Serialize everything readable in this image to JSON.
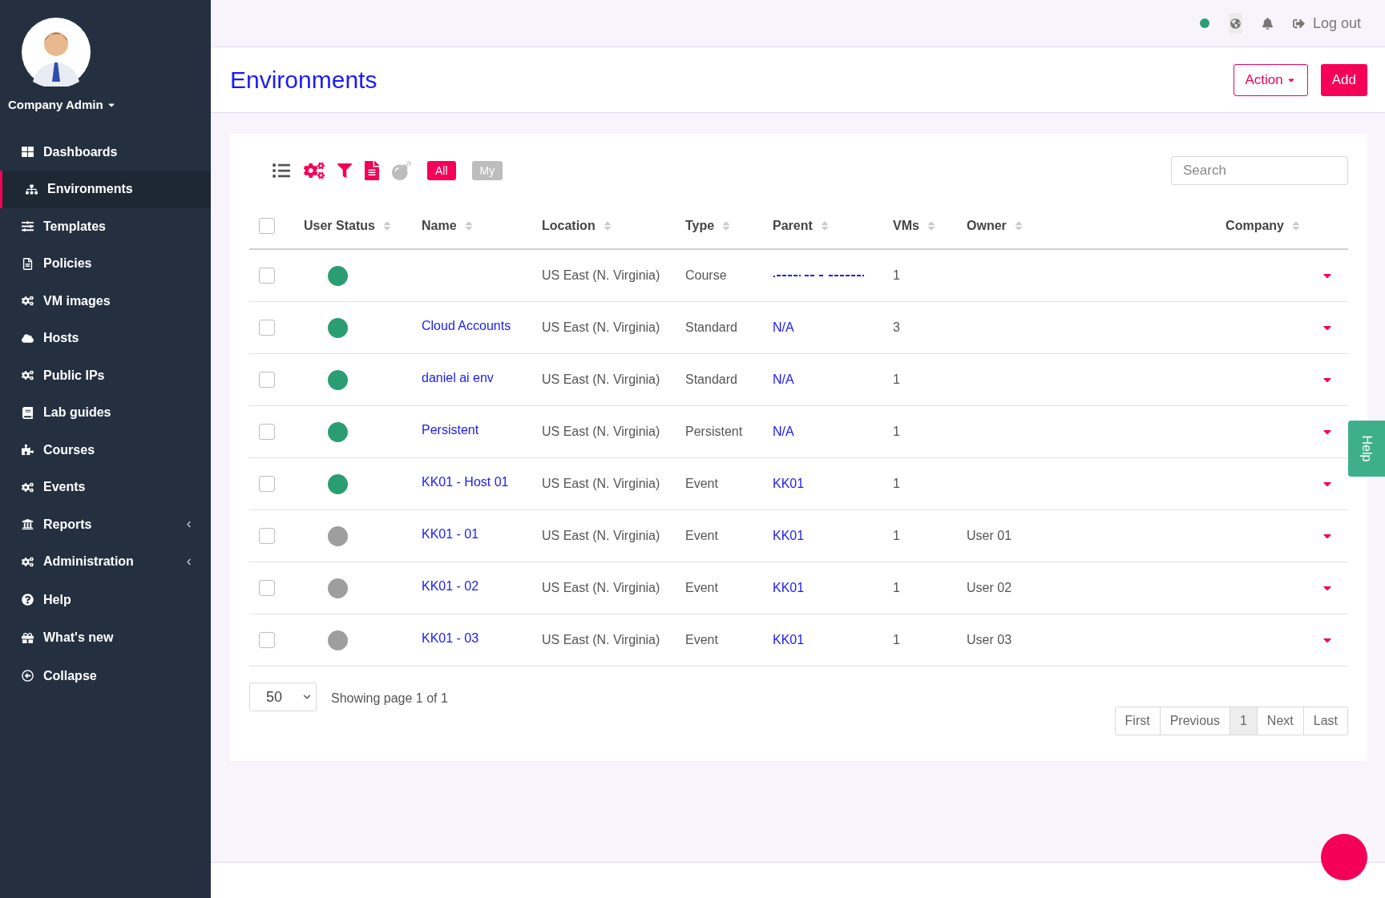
{
  "user": {
    "name": "Company Admin"
  },
  "sidebar": {
    "items": [
      {
        "label": "Dashboards",
        "selected": false,
        "expandable": false
      },
      {
        "label": "Environments",
        "selected": true,
        "expandable": false
      },
      {
        "label": "Templates",
        "selected": false,
        "expandable": false
      },
      {
        "label": "Policies",
        "selected": false,
        "expandable": false
      },
      {
        "label": "VM images",
        "selected": false,
        "expandable": false
      },
      {
        "label": "Hosts",
        "selected": false,
        "expandable": false
      },
      {
        "label": "Public IPs",
        "selected": false,
        "expandable": false
      },
      {
        "label": "Lab guides",
        "selected": false,
        "expandable": false
      },
      {
        "label": "Courses",
        "selected": false,
        "expandable": false
      },
      {
        "label": "Events",
        "selected": false,
        "expandable": false
      },
      {
        "label": "Reports",
        "selected": false,
        "expandable": true
      },
      {
        "label": "Administration",
        "selected": false,
        "expandable": true
      },
      {
        "label": "Help",
        "selected": false,
        "expandable": false
      },
      {
        "label": "What's new",
        "selected": false,
        "expandable": false
      },
      {
        "label": "Collapse",
        "selected": false,
        "expandable": false
      }
    ]
  },
  "topbar": {
    "connected": true,
    "logout": "Log out"
  },
  "page": {
    "title": "Environments",
    "action_button": "Action",
    "add_button": "Add"
  },
  "filters": [
    {
      "label": "All",
      "selected": true
    },
    {
      "label": "My",
      "selected": false
    }
  ],
  "search": {
    "placeholder": "Search"
  },
  "table": {
    "select_all": {
      "checked": false
    },
    "columns": [
      "User Status",
      "Name",
      "Location",
      "Type",
      "Parent",
      "VMs",
      "Owner",
      "Company"
    ],
    "rows": [
      {
        "checked": false,
        "color": "#2a9d73",
        "location": "US East (N. Virginia)",
        "type": "Course",
        "vms": "1"
      },
      {
        "checked": false,
        "color": "#2a9d73",
        "name": "Cloud Accounts",
        "location": "US East (N. Virginia)",
        "type": "Standard",
        "parent": "N/A",
        "vms": "3"
      },
      {
        "checked": false,
        "color": "#2a9d73",
        "name": "daniel ai env",
        "location": "US East (N. Virginia)",
        "type": "Standard",
        "parent": "N/A",
        "vms": "1"
      },
      {
        "checked": false,
        "color": "#2a9d73",
        "name": "Persistent",
        "location": "US East (N. Virginia)",
        "type": "Persistent",
        "parent": "N/A",
        "vms": "1"
      },
      {
        "checked": false,
        "color": "#2a9d73",
        "name": "KK01 - Host 01",
        "location": "US East (N. Virginia)",
        "type": "Event",
        "parent": "KK01",
        "vms": "1"
      },
      {
        "checked": false,
        "color": "#9e9e9e",
        "name": "KK01 - 01",
        "location": "US East (N. Virginia)",
        "type": "Event",
        "parent": "KK01",
        "vms": "1",
        "owner": "User 01"
      },
      {
        "checked": false,
        "color": "#9e9e9e",
        "name": "KK01 - 02",
        "location": "US East (N. Virginia)",
        "type": "Event",
        "parent": "KK01",
        "vms": "1",
        "owner": "User 02"
      },
      {
        "checked": false,
        "color": "#9e9e9e",
        "name": "KK01 - 03",
        "location": "US East (N. Virginia)",
        "type": "Event",
        "parent": "KK01",
        "vms": "1",
        "owner": "User 03"
      }
    ]
  },
  "page_size": "50",
  "page_info": "Showing page 1 of 1",
  "pagination": [
    {
      "label": "First",
      "selected": false
    },
    {
      "label": "Previous",
      "selected": false
    },
    {
      "label": "1",
      "selected": true
    },
    {
      "label": "Next",
      "selected": false
    },
    {
      "label": "Last",
      "selected": false
    }
  ],
  "help_tab": "Help"
}
